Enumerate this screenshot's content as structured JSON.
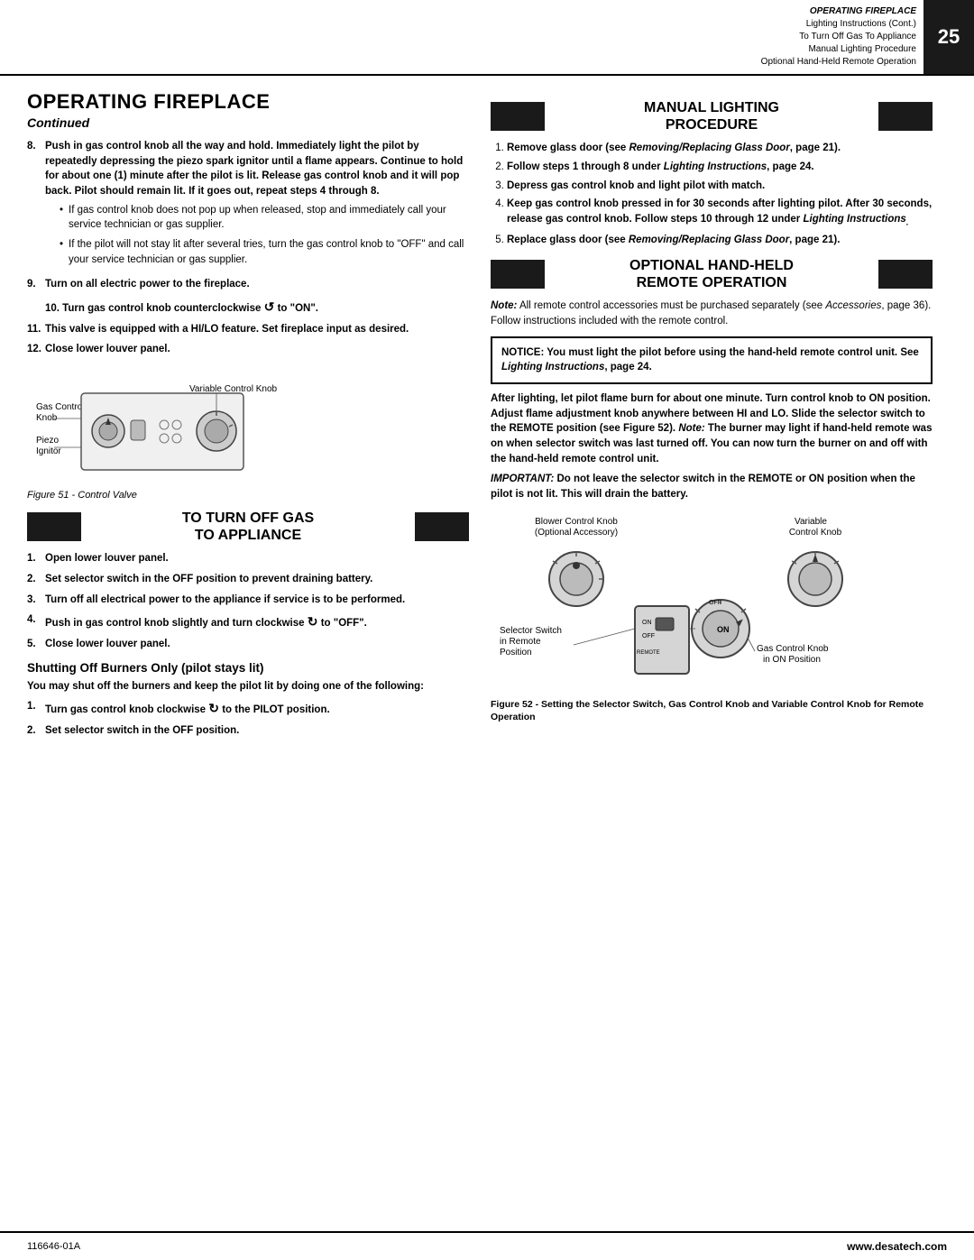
{
  "header": {
    "title": "OPERATING FIREPLACE",
    "subtitle1": "Lighting Instructions (Cont.)",
    "subtitle2": "To Turn Off Gas To Appliance",
    "subtitle3": "Manual Lighting Procedure",
    "subtitle4": "Optional Hand-Held Remote Operation",
    "page_number": "25"
  },
  "left": {
    "section_title": "OPERATING FIREPLACE",
    "section_subtitle": "Continued",
    "step8": {
      "text": "Push in gas control knob all the way and hold. Immediately light the pilot by repeatedly depressing the piezo spark ignitor until a flame appears. Continue to hold for about one (1) minute after the pilot is lit. Release gas control knob and it will pop back. Pilot should remain lit. If it goes out, repeat steps 4 through 8."
    },
    "bullet1": "If gas control knob does not pop up when released, stop and immediately call your service technician or gas supplier.",
    "bullet2": "If the pilot will not stay lit after several tries, turn the gas control knob to \"OFF\" and call your service technician or gas supplier.",
    "step9": "Turn on all electric power to the fireplace.",
    "step10_prefix": "10. Turn gas control knob counterclockwise",
    "step10_suffix": "to \"ON\".",
    "step11": "This valve is equipped with a HI/LO feature. Set fireplace input as desired.",
    "step12": "Close lower louver panel.",
    "figure51_caption": "Figure 51 - Control Valve",
    "diagram": {
      "label_gas_control": "Gas Control",
      "label_knob": "Knob",
      "label_piezo": "Piezo",
      "label_ignitor": "Ignitor",
      "label_variable": "Variable Control Knob"
    },
    "to_turn_off_banner": "TO TURN OFF GAS\nTO APPLIANCE",
    "off_step1": "Open lower louver panel.",
    "off_step2": "Set selector switch in the OFF position to prevent draining battery.",
    "off_step3": "Turn off all electrical power to the appliance if service is to be performed.",
    "off_step4_prefix": "Push in gas control knob slightly and turn clockwise",
    "off_step4_suffix": "to \"OFF\".",
    "off_step5": "Close lower louver panel.",
    "shutting_title": "Shutting Off Burners Only (pilot stays lit)",
    "shutting_para": "You may shut off the burners and keep the pilot lit by doing one of the following:",
    "shutting_step1_prefix": "Turn gas control knob clockwise",
    "shutting_step1_suffix": "to the PILOT position.",
    "shutting_step2": "Set selector switch in the OFF position."
  },
  "right": {
    "manual_lighting_banner": "MANUAL LIGHTING\nPROCEDURE",
    "ml_step1": "Remove glass door (see Removing/Replacing Glass Door, page 21).",
    "ml_step2": "Follow steps 1 through 8 under Lighting Instructions, page 24.",
    "ml_step3": "Depress gas control knob and light pilot with match.",
    "ml_step4": "Keep gas control knob pressed in for 30 seconds after lighting pilot. After 30 seconds, release gas control knob. Follow steps 10 through 12 under Lighting Instructions.",
    "ml_step5": "Replace glass door (see Removing/Replacing Glass Door, page 21).",
    "optional_banner": "OPTIONAL HAND-HELD\nREMOTE OPERATION",
    "note_text": "Note: All remote control accessories must be purchased separately (see Accessories, page 36). Follow instructions included with the remote control.",
    "notice_text": "NOTICE: You must light the pilot before using the hand-held remote control unit. See Lighting Instructions, page 24.",
    "after_lighting_para": "After lighting, let pilot flame burn for about one minute. Turn control knob to ON position. Adjust flame adjustment knob anywhere between HI and LO. Slide the selector switch to the REMOTE position (see Figure 52). Note: The burner may light if hand-held remote was on when selector switch was last turned off. You can now turn the burner on and off with the hand-held remote control unit.",
    "important_para": "IMPORTANT: Do not leave the selector switch in the REMOTE or ON position when the pilot is not lit. This will drain the battery.",
    "fig52_caption": "Figure 52 - Setting the Selector Switch, Gas Control Knob and Variable Control Knob for Remote Operation",
    "labels": {
      "blower_control": "Blower Control Knob",
      "optional_acc": "(Optional Accessory)",
      "variable_control": "Variable\nControl Knob",
      "selector_switch": "Selector Switch",
      "in_remote": "in Remote",
      "position": "Position",
      "gas_control_knob": "Gas Control Knob",
      "in_on_position": "in ON Position"
    }
  },
  "footer": {
    "part_number": "116646-01A",
    "website": "www.desatech.com"
  }
}
